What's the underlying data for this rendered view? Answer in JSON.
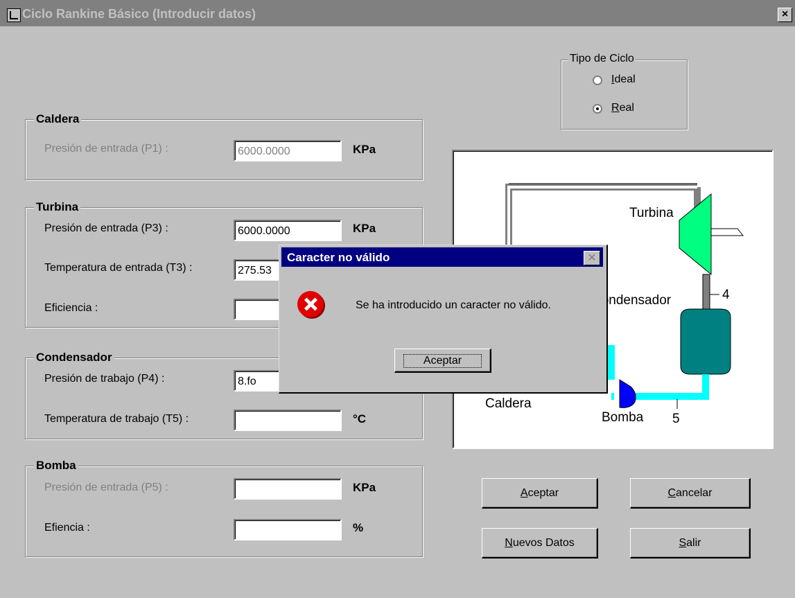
{
  "window": {
    "title": "Ciclo Rankine Básico (Introducir datos)",
    "close_label": "×"
  },
  "caldera": {
    "legend": "Caldera",
    "p1_label": "Presión de entrada (P1) :",
    "p1_value": "6000.0000",
    "p1_unit": "KPa"
  },
  "turbina": {
    "legend": "Turbina",
    "p3_label": "Presión de entrada (P3) :",
    "p3_value": "6000.0000",
    "p3_unit": "KPa",
    "t3_label": "Temperatura de entrada (T3) :",
    "t3_value": "275.53",
    "ef_label": "Eficiencia :",
    "ef_value": ""
  },
  "condensador": {
    "legend": "Condensador",
    "p4_label": "Presión de trabajo (P4) :",
    "p4_value": "8.fo",
    "t5_label": "Temperatura de trabajo (T5) :",
    "t5_value": "",
    "t5_unit": "°C"
  },
  "bomba": {
    "legend": "Bomba",
    "p5_label": "Presión de entrada (P5) :",
    "p5_value": "",
    "p5_unit": "KPa",
    "ef_label": "Efiencia :",
    "ef_value": "",
    "ef_unit": "%"
  },
  "tipo_ciclo": {
    "legend": "Tipo de Ciclo",
    "options": [
      {
        "label": "Ideal",
        "selected": false
      },
      {
        "label": "Real",
        "selected": true
      }
    ]
  },
  "diagram": {
    "turbina": "Turbina",
    "condensador": "Condensador",
    "caldera": "Caldera",
    "bomba": "Bomba",
    "point4": "4",
    "point5": "5",
    "colors": {
      "turbine": "#00ff80",
      "condenser": "#008080",
      "pump": "#0000ff",
      "water": "#00ffff",
      "pipe": "#808080"
    }
  },
  "buttons": {
    "aceptar": "Aceptar",
    "cancelar": "Cancelar",
    "nuevos": "Nuevos Datos",
    "salir": "Salir"
  },
  "dialog": {
    "title": "Caracter no válido",
    "message": "Se ha introducido un caracter no válido.",
    "ok": "Aceptar",
    "icon": "error-icon"
  }
}
